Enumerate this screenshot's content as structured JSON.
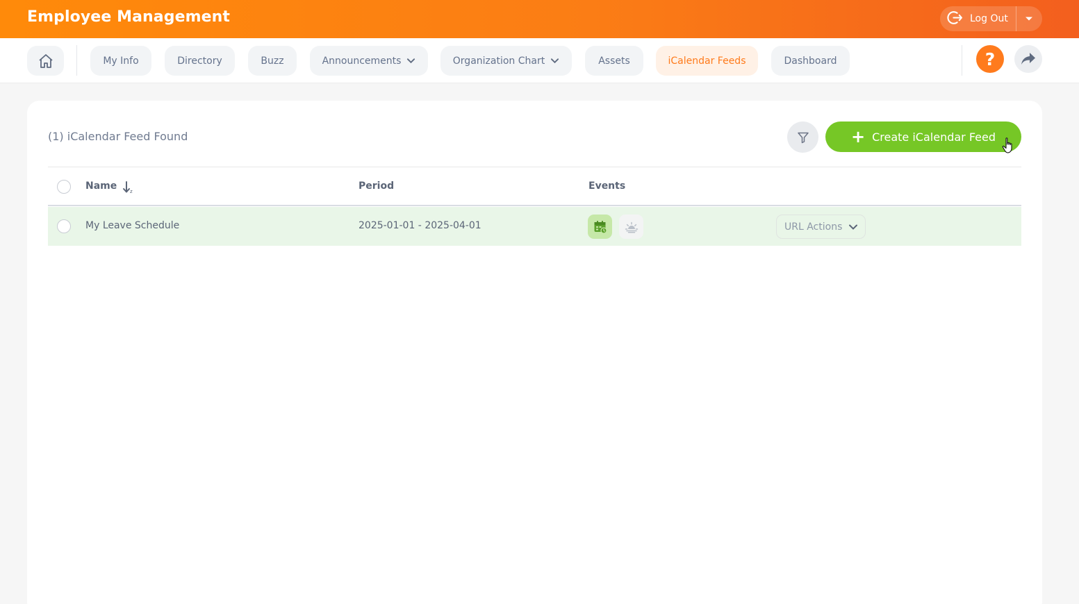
{
  "app": {
    "title": "Employee Management"
  },
  "header": {
    "logout_label": "Log Out"
  },
  "nav": {
    "tabs": [
      {
        "label": "My Info"
      },
      {
        "label": "Directory"
      },
      {
        "label": "Buzz"
      },
      {
        "label": "Announcements",
        "has_dropdown": true
      },
      {
        "label": "Organization Chart",
        "has_dropdown": true
      },
      {
        "label": "Assets"
      },
      {
        "label": "iCalendar Feeds",
        "active": true
      },
      {
        "label": "Dashboard"
      }
    ],
    "help_glyph": "?"
  },
  "list": {
    "found_text": "(1) iCalendar Feed Found",
    "create_label": "Create iCalendar Feed",
    "columns": [
      "Name",
      "Period",
      "Events"
    ],
    "rows": [
      {
        "name": "My Leave Schedule",
        "period": "2025-01-01 - 2025-04-01",
        "events": [
          "leave-calendar-icon",
          "holiday-sun-icon"
        ],
        "action_label": "URL Actions"
      }
    ]
  },
  "colors": {
    "header_gradient_start": "#ff8a0a",
    "header_gradient_end": "#f35f1e",
    "accent": "#ff7b1d",
    "create_button": "#76c726",
    "row_highlight": "#e9f6e8"
  }
}
